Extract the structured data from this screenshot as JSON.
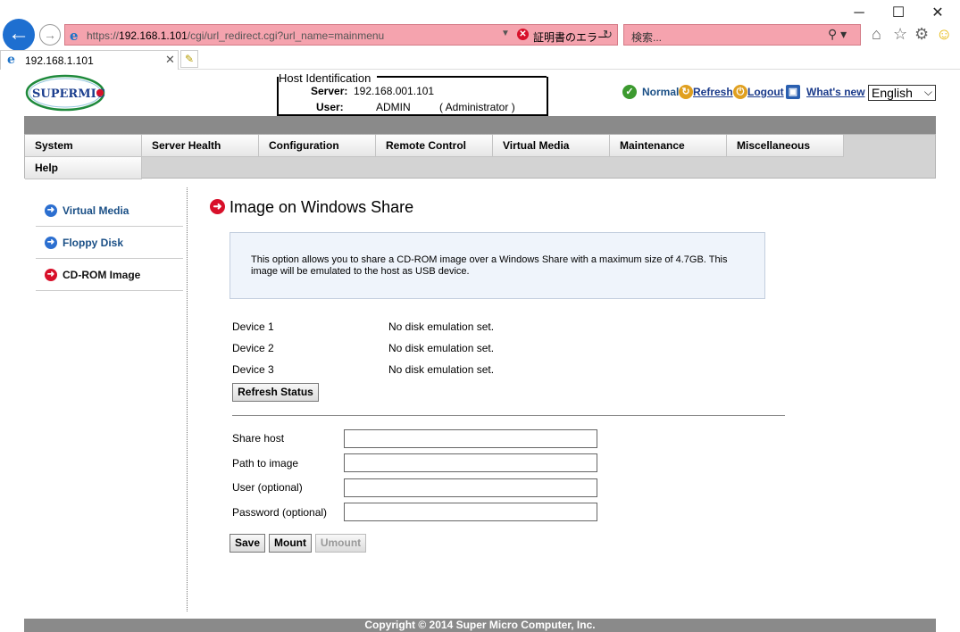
{
  "browser": {
    "url_prefix": "https://",
    "url_host": "192.168.1.101",
    "url_path": "/cgi/url_redirect.cgi?url_name=mainmenu",
    "cert_error": "証明書のエラー",
    "search_placeholder": "検索...",
    "tab_title": "192.168.1.101"
  },
  "header": {
    "host_legend": "Host Identification",
    "server_label": "Server:",
    "server_value": "192.168.001.101",
    "user_label": "User:",
    "user_value": "ADMIN",
    "user_role": "( Administrator )",
    "links": {
      "normal": "Normal",
      "refresh": "Refresh",
      "logout": "Logout",
      "whats_new": "What's  new"
    },
    "language": "English"
  },
  "menu": {
    "items": [
      "System",
      "Server Health",
      "Configuration",
      "Remote Control",
      "Virtual Media",
      "Maintenance",
      "Miscellaneous"
    ],
    "help": "Help"
  },
  "sidebar": {
    "items": [
      {
        "label": "Virtual Media",
        "active": false
      },
      {
        "label": "Floppy Disk",
        "active": false
      },
      {
        "label": "CD-ROM Image",
        "active": true
      }
    ]
  },
  "main": {
    "title": "Image on Windows Share",
    "info": "This option allows you to share a CD-ROM image over a Windows Share with a maximum size of 4.7GB. This image will be emulated to the host as USB device.",
    "devices": [
      {
        "label": "Device 1",
        "status": "No disk emulation set."
      },
      {
        "label": "Device 2",
        "status": "No disk emulation set."
      },
      {
        "label": "Device 3",
        "status": "No disk emulation set."
      }
    ],
    "refresh_status": "Refresh Status",
    "fields": [
      {
        "label": "Share host",
        "value": ""
      },
      {
        "label": "Path to image",
        "value": ""
      },
      {
        "label": "User (optional)",
        "value": ""
      },
      {
        "label": "Password (optional)",
        "value": ""
      }
    ],
    "save": "Save",
    "mount": "Mount",
    "umount": "Umount"
  },
  "footer": {
    "copyright": "Copyright © 2014 Super Micro Computer, Inc."
  },
  "colors": {
    "accent_red": "#d8102a",
    "link_blue": "#1e73c8",
    "nav_text": "#1a4f86",
    "sidebar_active": "#000000"
  }
}
